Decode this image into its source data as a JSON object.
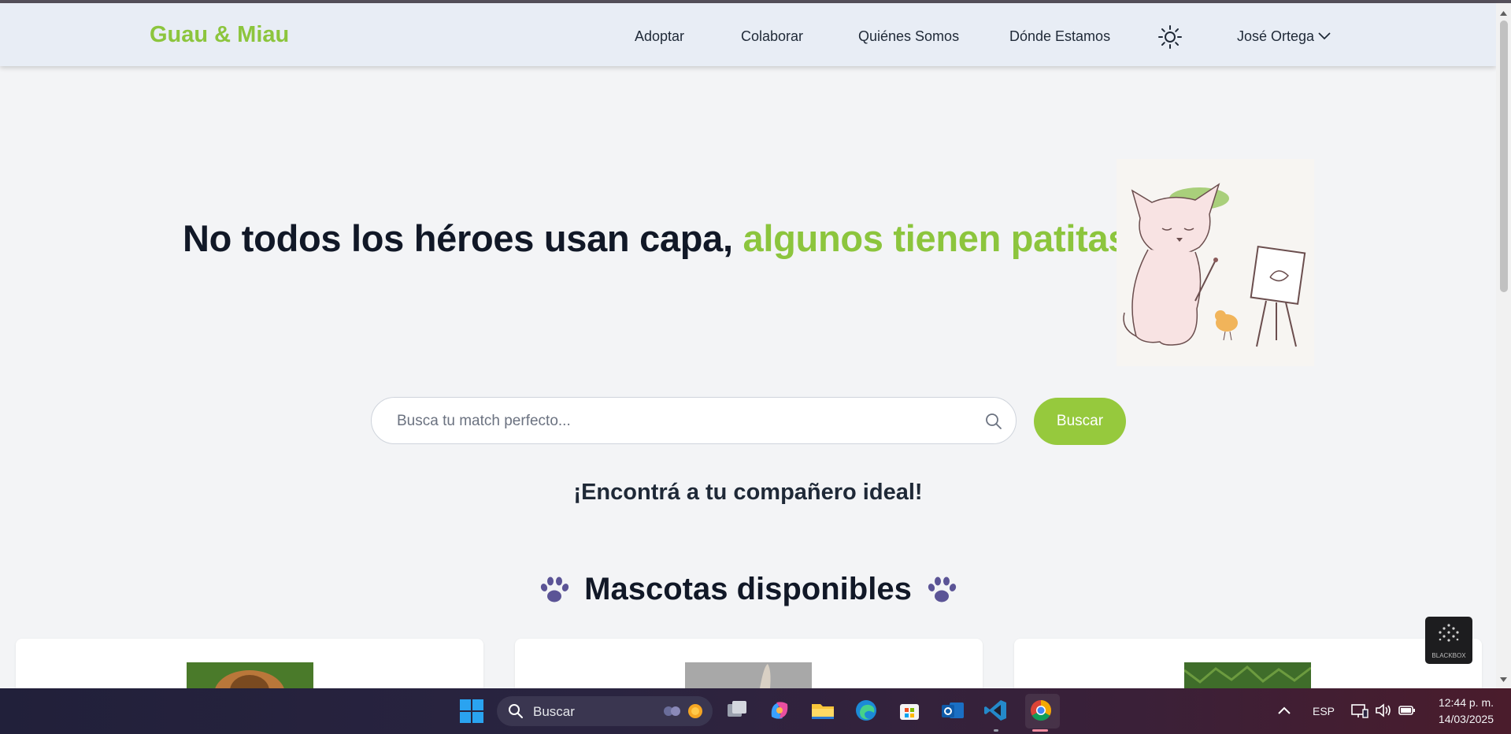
{
  "navbar": {
    "brand": "Guau & Miau",
    "items": [
      "Adoptar",
      "Colaborar",
      "Quiénes Somos",
      "Dónde Estamos"
    ],
    "theme_toggle_icon": "sun-icon",
    "user_name": "José Ortega"
  },
  "hero": {
    "headline_part1": "No todos los héroes usan capa,",
    "headline_part2": "algunos tienen patitas.",
    "illustration": "cat-painter-illustration"
  },
  "search": {
    "placeholder": "Busca tu match perfecto...",
    "button_label": "Buscar"
  },
  "tagline": "¡Encontrá a tu compañero ideal!",
  "section": {
    "title": "Mascotas disponibles",
    "decor_icon": "paw-icon"
  },
  "cards": [
    {
      "image": "dog-photo"
    },
    {
      "image": "pet-photo"
    },
    {
      "image": "grass-photo"
    }
  ],
  "floating_badge": {
    "label": "BLACKBOX"
  },
  "taskbar": {
    "search_label": "Buscar",
    "language": "ESP",
    "time": "12:44 p. m.",
    "date": "14/03/2025"
  },
  "colors": {
    "brand_green": "#8cc53d",
    "button_green": "#96c93d",
    "paw_purple": "#5b5496"
  }
}
